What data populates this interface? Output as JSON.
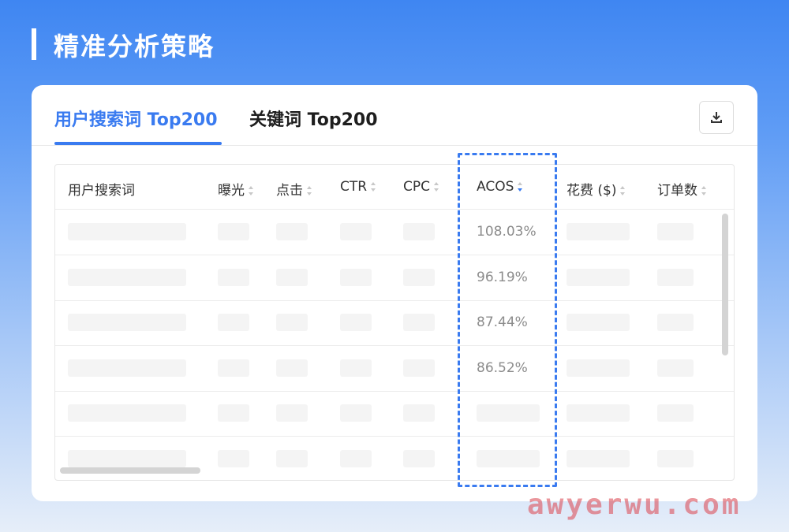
{
  "page": {
    "title": "精准分析策略"
  },
  "tabs": [
    {
      "label": "用户搜索词 Top200",
      "active": true
    },
    {
      "label": "关键词 Top200",
      "active": false
    }
  ],
  "download": {
    "icon": "download-icon"
  },
  "table": {
    "columns": [
      "用户搜索词",
      "曝光",
      "点击",
      "CTR",
      "CPC",
      "ACOS",
      "花费 ($)",
      "订单数"
    ],
    "sorted_column": "ACOS",
    "sort_direction": "descending",
    "acos_values": [
      "108.03%",
      "96.19%",
      "87.44%",
      "86.52%"
    ]
  },
  "colors": {
    "accent": "#3a7bf0",
    "background_top": "#3f86f2"
  },
  "watermark": "awyerwu.com"
}
